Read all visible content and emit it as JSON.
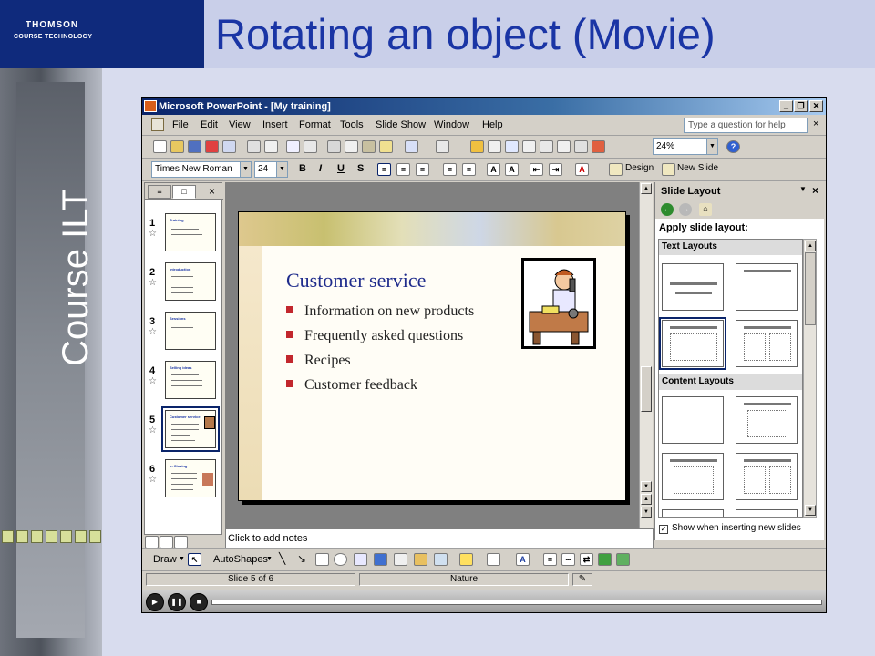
{
  "header": {
    "logo_line1": "THOMSON",
    "logo_line2": "COURSE TECHNOLOGY",
    "title": "Rotating an object (Movie)",
    "side_label": "Course ILT"
  },
  "window": {
    "title": "Microsoft PowerPoint - [My training]",
    "minimize": "_",
    "restore": "❐",
    "close": "✕"
  },
  "menu": {
    "items": [
      "File",
      "Edit",
      "View",
      "Insert",
      "Format",
      "Tools",
      "Slide Show",
      "Window",
      "Help"
    ],
    "ask_placeholder": "Type a question for help",
    "close_doc": "×"
  },
  "toolbar": {
    "zoom": "24%"
  },
  "format_bar": {
    "font": "Times New Roman",
    "size": "24",
    "bold": "B",
    "italic": "I",
    "underline": "U",
    "shadow": "S",
    "design_label": "Design",
    "new_slide_label": "New Slide"
  },
  "outline_pane": {
    "close": "×",
    "slides": [
      {
        "num": "1",
        "title": "Training"
      },
      {
        "num": "2",
        "title": "Introduction"
      },
      {
        "num": "3",
        "title": "Sessions"
      },
      {
        "num": "4",
        "title": "Selling ideas"
      },
      {
        "num": "5",
        "title": "Customer service"
      },
      {
        "num": "6",
        "title": "In Closing"
      }
    ]
  },
  "slide": {
    "title": "Customer service",
    "bullets": [
      "Information on new products",
      "Frequently asked questions",
      "Recipes",
      "Customer feedback"
    ]
  },
  "notes_placeholder": "Click to add notes",
  "task_pane": {
    "title": "Slide Layout",
    "apply_label": "Apply slide layout:",
    "text_layouts_label": "Text Layouts",
    "content_layouts_label": "Content Layouts",
    "show_checkbox_label": "Show when inserting new slides"
  },
  "draw_bar": {
    "draw_label": "Draw",
    "autoshapes_label": "AutoShapes"
  },
  "status": {
    "slide_info": "Slide 5 of 6",
    "design": "Nature"
  },
  "colors": {
    "title_blue": "#1a35a5",
    "logo_navy": "#0f2a7c",
    "bullet_red": "#c2272d",
    "slide_title": "#1f2c8c"
  }
}
